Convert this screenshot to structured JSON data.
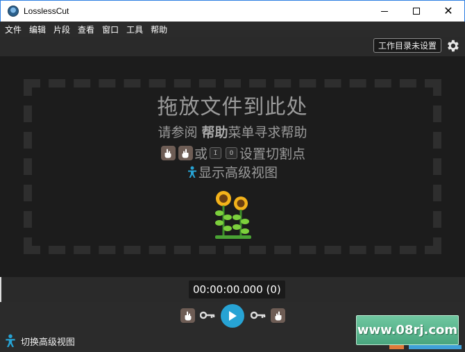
{
  "window": {
    "title": "LosslessCut",
    "minimize_label": "",
    "maximize_label": "",
    "close_label": "✕"
  },
  "menu": {
    "items": [
      "文件",
      "编辑",
      "片段",
      "查看",
      "窗口",
      "工具",
      "帮助"
    ]
  },
  "topbar": {
    "workdir_label": "工作目录未设置"
  },
  "main": {
    "drop_title": "拖放文件到此处",
    "help_prefix": "请参阅 ",
    "help_bold": "帮助",
    "help_suffix": "菜单寻求帮助",
    "cut_or": "或",
    "cut_key_in": "I",
    "cut_key_out": "O",
    "cut_suffix": "设置切割点",
    "advanced_label": "显示高级视图"
  },
  "timeline": {
    "timecode": "00:00:00.000 (0)"
  },
  "controls": {
    "advanced_toggle_label": "切换高级视图"
  },
  "watermark": {
    "text": "www.08rj.com"
  },
  "colors": {
    "accent": "#27a3d4",
    "hand_bg": "#6e5d55",
    "watermark_green": "#5bb58e"
  }
}
